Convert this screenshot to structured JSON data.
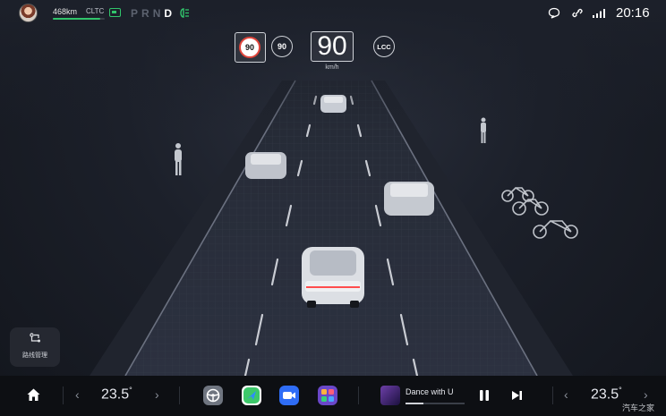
{
  "status": {
    "range": "468km",
    "range_level": 0.92,
    "range_standard": "CLTC",
    "gears": [
      "P",
      "R",
      "N",
      "D"
    ],
    "active_gear": "D",
    "time": "20:16",
    "icons": [
      "avatar",
      "battery-icon",
      "headlight-icon",
      "message-icon",
      "link-icon",
      "signal-icon"
    ]
  },
  "cluster": {
    "speed_limit": "90",
    "cruise_speed": "90",
    "current_speed": "90",
    "speed_unit": "km/h",
    "assist_mode": "LCC"
  },
  "route_card": {
    "label": "路线管理"
  },
  "dock": {
    "left_temp": "23.5",
    "right_temp": "23.5",
    "temp_unit": "°",
    "song_title": "Dance with U",
    "song_progress": 0.3,
    "apps": [
      "steering-app",
      "navigation-app",
      "video-call-app",
      "app-grid"
    ],
    "watermark": "汽车之家"
  },
  "colors": {
    "accent_green": "#31c46b",
    "limit_red": "#e0453b",
    "background": "#1c202a"
  }
}
